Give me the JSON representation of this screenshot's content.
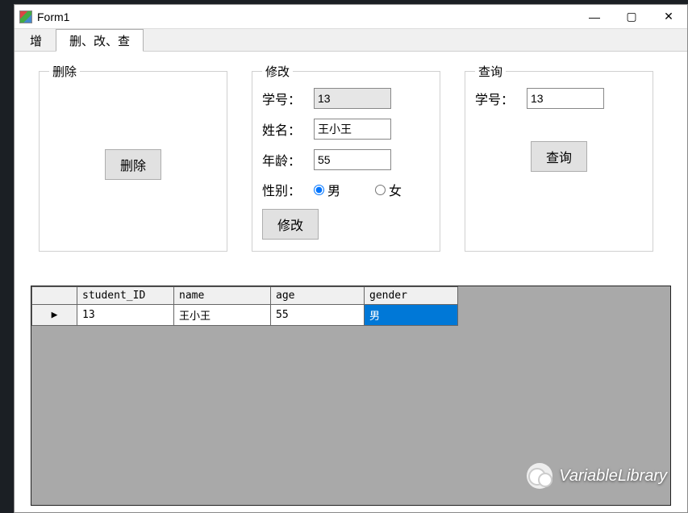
{
  "window": {
    "title": "Form1"
  },
  "tabs": {
    "inactive": "增",
    "active": "删、改、查"
  },
  "groups": {
    "delete": {
      "title": "删除",
      "button": "删除"
    },
    "modify": {
      "title": "修改",
      "labels": {
        "id": "学号：",
        "name": "姓名：",
        "age": "年龄：",
        "gender": "性别："
      },
      "values": {
        "id": "13",
        "name": "王小王",
        "age": "55"
      },
      "gender_options": {
        "male": "男",
        "female": "女"
      },
      "gender_checked": "male",
      "button": "修改"
    },
    "query": {
      "title": "查询",
      "label": "学号：",
      "value": "13",
      "button": "查询"
    }
  },
  "grid": {
    "columns": [
      "student_ID",
      "name",
      "age",
      "gender"
    ],
    "rows": [
      {
        "student_ID": "13",
        "name": "王小王",
        "age": "55",
        "gender": "男"
      }
    ],
    "selected": {
      "row": 0,
      "col": "gender"
    },
    "row_marker": "▶"
  },
  "watermark": "VariableLibrary"
}
